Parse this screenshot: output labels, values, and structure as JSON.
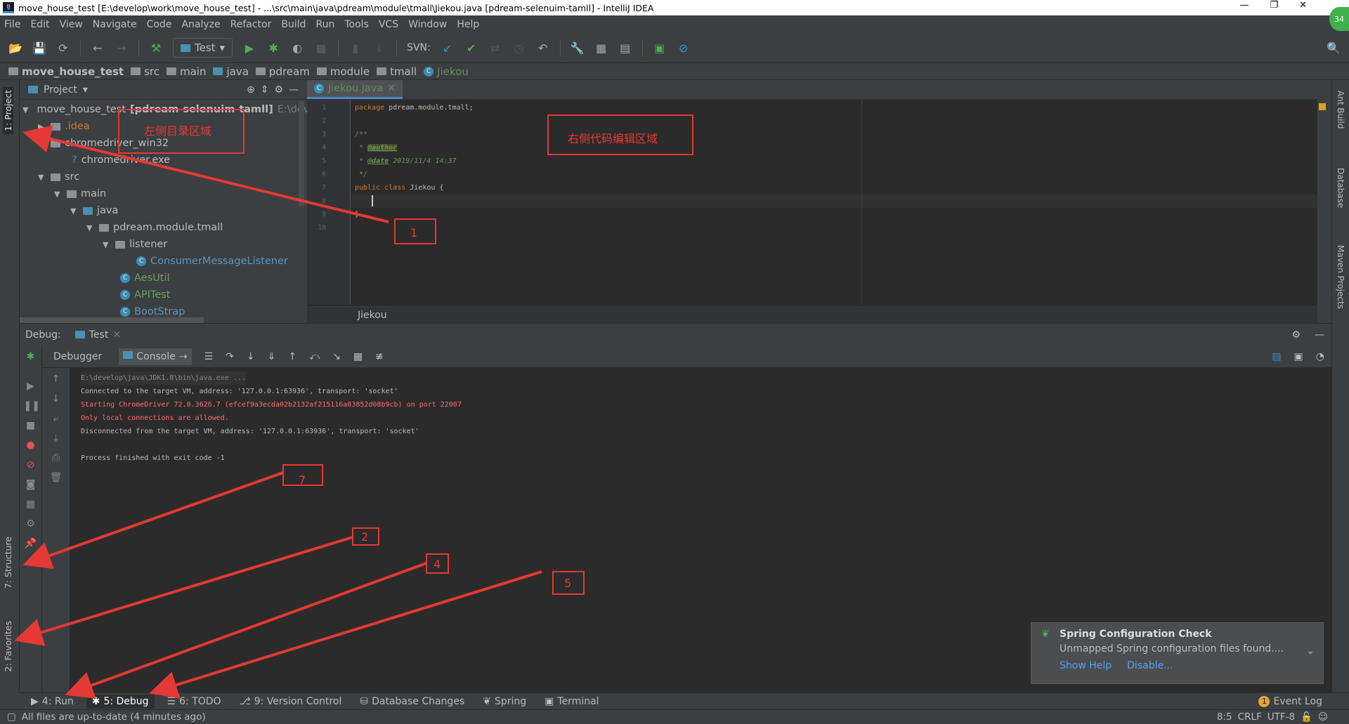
{
  "window": {
    "title": "move_house_test [E:\\develop\\work\\move_house_test] - ...\\src\\main\\java\\pdream\\module\\tmall\\Jiekou.java [pdream-selenuim-tamll] - IntelliJ IDEA",
    "app_icon": "IJ",
    "avatar": "34"
  },
  "menu": [
    "File",
    "Edit",
    "View",
    "Navigate",
    "Code",
    "Analyze",
    "Refactor",
    "Build",
    "Run",
    "Tools",
    "VCS",
    "Window",
    "Help"
  ],
  "toolbar": {
    "run_config": "Test",
    "svn_label": "SVN:"
  },
  "breadcrumb": [
    "move_house_test",
    "src",
    "main",
    "java",
    "pdream",
    "module",
    "tmall",
    "Jiekou"
  ],
  "left_strip": {
    "project": "1: Project",
    "structure": "7: Structure",
    "favorites": "2: Favorites"
  },
  "right_strip": {
    "ant": "Ant Build",
    "database": "Database",
    "maven": "Maven Projects"
  },
  "project": {
    "title": "Project",
    "tree": [
      {
        "label": "move_house_test",
        "bold": "[pdream-selenuim-tamll]",
        "extra": "E:\\develo"
      },
      {
        "label": ".idea"
      },
      {
        "label": "chromedriver_win32"
      },
      {
        "label": "chromedriver.exe"
      },
      {
        "label": "src"
      },
      {
        "label": "main"
      },
      {
        "label": "java"
      },
      {
        "label": "pdream.module.tmall"
      },
      {
        "label": "listener"
      },
      {
        "label": "ConsumerMessageListener"
      },
      {
        "label": "AesUtil"
      },
      {
        "label": "APITest"
      },
      {
        "label": "BootStrap"
      }
    ]
  },
  "editor": {
    "tab": "Jiekou.java",
    "line_numbers": [
      "1",
      "2",
      "3",
      "4",
      "5",
      "6",
      "7",
      "8",
      "9",
      "10"
    ],
    "code": {
      "l1_kw": "package",
      "l1": " pdream.module.tmall;",
      "l3": "/**",
      "l4a": " * ",
      "l4tag": "@author",
      "l5a": " * ",
      "l5tag": "@date",
      "l5b": " 2019/11/4 14:37",
      "l6": " */",
      "l7_kw": "public class",
      "l7": " Jiekou {",
      "l9": "}"
    },
    "crumb": "Jiekou"
  },
  "debug": {
    "label": "Debug:",
    "tab": "Test",
    "debugger_tab": "Debugger",
    "console_tab": "Console"
  },
  "console": [
    "E:\\develop\\java\\JDK1.8\\bin\\java.exe ...",
    "Connected to the target VM, address: '127.0.0.1:63936', transport: 'socket'",
    "Starting ChromeDriver 72.0.3626.7 (efcef9a3ecda02b2132af215116a03852d08b9cb) on port 22007",
    "Only local connections are allowed.",
    "Disconnected from the target VM, address: '127.0.0.1:63936', transport: 'socket'",
    "",
    "Process finished with exit code -1"
  ],
  "bottom_tabs": [
    "4: Run",
    "5: Debug",
    "6: TODO",
    "9: Version Control",
    "Database Changes",
    "Spring",
    "Terminal"
  ],
  "event_log": {
    "count": "1",
    "label": "Event Log"
  },
  "status": {
    "message": "All files are up-to-date (4 minutes ago)",
    "position": "8:5",
    "line_sep": "CRLF",
    "encoding": "UTF-8"
  },
  "notification": {
    "title": "Spring Configuration Check",
    "message": "Unmapped Spring configuration files found....",
    "show_help": "Show Help",
    "disable": "Disable..."
  },
  "annotations": {
    "left_area": "左侧目录区域",
    "right_area": "右侧代码编辑区域",
    "n1": "1",
    "n7": "7",
    "n2": "2",
    "n4": "4",
    "n5": "5",
    "color": "#e53935"
  }
}
